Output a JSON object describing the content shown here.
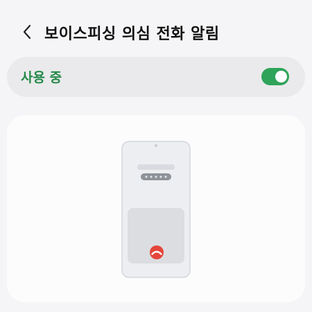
{
  "header": {
    "title": "보이스피싱 의심 전화 알림",
    "back_icon": "chevron-left-icon"
  },
  "toggle": {
    "label": "사용 중",
    "checked": true,
    "accent_color": "#2fa35a",
    "label_color": "#238847"
  },
  "illustration": {
    "icon": "decline-call-icon",
    "decline_color": "#e5453b"
  }
}
